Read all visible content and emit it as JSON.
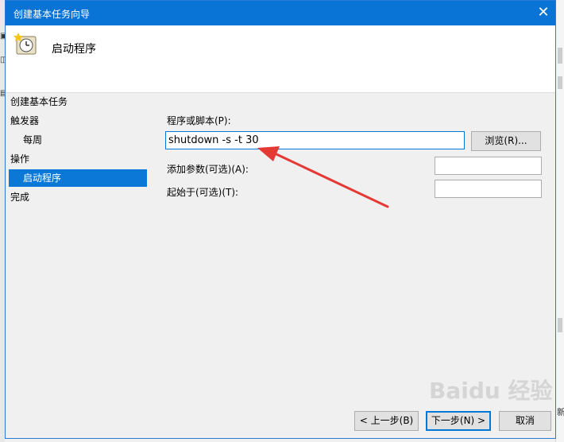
{
  "window": {
    "title": "创建基本任务向导",
    "close_glyph": "✕"
  },
  "header": {
    "title": "启动程序"
  },
  "nav": {
    "items": [
      {
        "label": "创建基本任务"
      },
      {
        "label": "触发器"
      },
      {
        "label": "每周"
      },
      {
        "label": "操作"
      },
      {
        "label": "启动程序"
      },
      {
        "label": "完成"
      }
    ]
  },
  "form": {
    "program_label": "程序或脚本(P):",
    "program_value": "shutdown -s -t 30",
    "browse_label": "浏览(R)...",
    "args_label": "添加参数(可选)(A):",
    "args_value": "",
    "start_label": "起始于(可选)(T):",
    "start_value": ""
  },
  "buttons": {
    "back": "< 上一步(B)",
    "next": "下一步(N) >",
    "cancel": "取消"
  },
  "annotation": {
    "arrow_color": "#e53935"
  },
  "watermark": {
    "text": "Baidu 经验"
  },
  "background": {
    "right_text": [
      "新"
    ]
  }
}
